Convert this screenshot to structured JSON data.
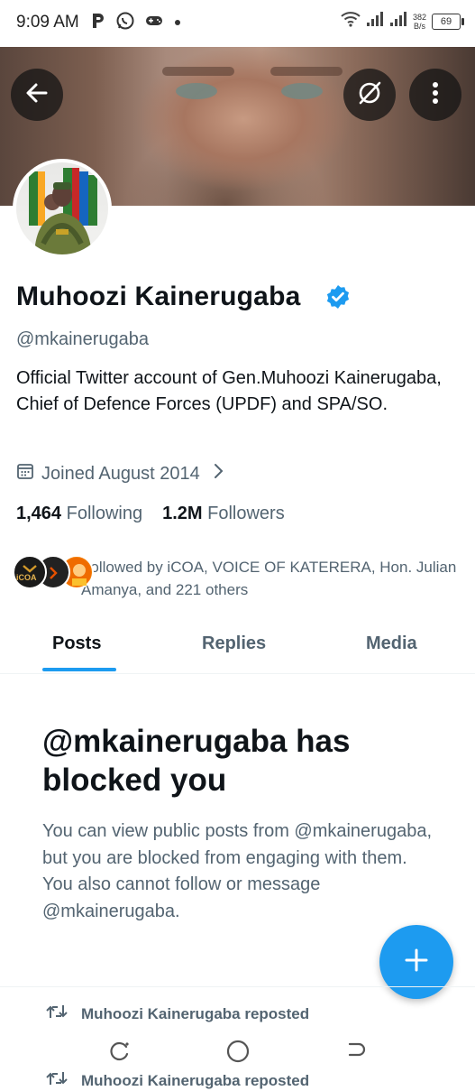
{
  "status_bar": {
    "time": "9:09 AM",
    "speed_value": "382",
    "speed_unit": "B/s",
    "battery": "69",
    "icons": [
      "p-icon",
      "whatsapp-icon",
      "gamepad-icon",
      "dot-icon",
      "wifi-icon",
      "signal-icon",
      "signal-icon",
      "battery-icon"
    ]
  },
  "header": {
    "back_icon": "arrow-left-icon",
    "grok_icon": "grok-icon",
    "more_icon": "more-vertical-icon"
  },
  "profile": {
    "name": "Muhoozi Kainerugaba",
    "verified": true,
    "handle": "@mkainerugaba",
    "bio": "Official Twitter account of Gen.Muhoozi Kainerugaba, Chief of Defence Forces (UPDF) and SPA/SO.",
    "joined": "Joined August 2014",
    "following_count": "1,464",
    "following_label": "Following",
    "followers_count": "1.2M",
    "followers_label": "Followers",
    "followed_by": "Followed by iCOA, VOICE OF KATERERA, Hon. Julian Amanya, and 221 others",
    "mini_avatar_text": "iCOA"
  },
  "tabs": [
    {
      "label": "Posts",
      "active": true
    },
    {
      "label": "Replies",
      "active": false
    },
    {
      "label": "Media",
      "active": false
    }
  ],
  "blocked": {
    "title": "@mkainerugaba has blocked you",
    "body": "You can view public posts from @mkainerugaba, but you are blocked from engaging with them. You also cannot follow or message @mkainerugaba."
  },
  "feed": {
    "repost_1": "Muhoozi Kainerugaba reposted",
    "repost_2": "Muhoozi Kainerugaba reposted"
  },
  "colors": {
    "accent": "#1d9bf0",
    "text_primary": "#0f1419",
    "text_secondary": "#536471"
  }
}
